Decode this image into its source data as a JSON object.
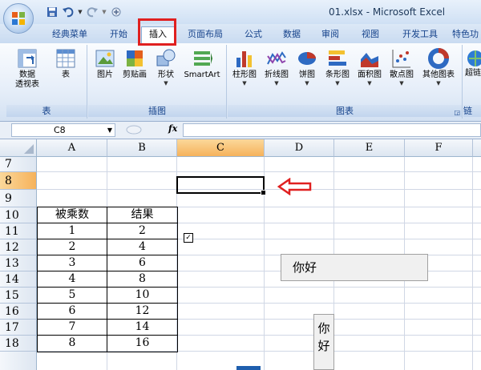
{
  "window": {
    "title": "01.xlsx - Microsoft Excel"
  },
  "quick_access": {
    "icons": [
      "save-icon",
      "undo-icon",
      "redo-icon",
      "customize-icon"
    ]
  },
  "ribbon_tabs": [
    {
      "label": "经典菜单",
      "active": false
    },
    {
      "label": "开始",
      "active": false
    },
    {
      "label": "插入",
      "active": true
    },
    {
      "label": "页面布局",
      "active": false
    },
    {
      "label": "公式",
      "active": false
    },
    {
      "label": "数据",
      "active": false
    },
    {
      "label": "审阅",
      "active": false
    },
    {
      "label": "视图",
      "active": false
    },
    {
      "label": "开发工具",
      "active": false
    },
    {
      "label": "特色功",
      "active": false
    }
  ],
  "ribbon": {
    "groups": {
      "table": "表",
      "illustrations": "插图",
      "charts": "图表",
      "links": "链"
    },
    "buttons": {
      "pivot_line1": "数据",
      "pivot_line2": "透视表",
      "table": "表",
      "picture": "图片",
      "clipart": "剪贴画",
      "shapes": "形状",
      "smartart": "SmartArt",
      "column": "柱形图",
      "line": "折线图",
      "pie": "饼图",
      "bar": "条形图",
      "area": "面积图",
      "scatter": "散点图",
      "other": "其他图表",
      "hyperlink": "超链"
    }
  },
  "formula_bar": {
    "name_box": "C8",
    "fx": "fx",
    "formula": ""
  },
  "columns": [
    "A",
    "B",
    "C",
    "D",
    "E",
    "F"
  ],
  "rows": [
    "7",
    "8",
    "9",
    "10",
    "11",
    "12",
    "13",
    "14",
    "15",
    "16",
    "17",
    "18"
  ],
  "selected": {
    "column": "C",
    "row": "8"
  },
  "table": {
    "header": [
      "被乘数",
      "结果"
    ],
    "rows": [
      [
        "1",
        "2"
      ],
      [
        "2",
        "4"
      ],
      [
        "3",
        "6"
      ],
      [
        "4",
        "8"
      ],
      [
        "5",
        "10"
      ],
      [
        "6",
        "12"
      ],
      [
        "7",
        "14"
      ],
      [
        "8",
        "16"
      ]
    ]
  },
  "controls": {
    "checkbox_checked": true,
    "textbox1": "你好",
    "textbox2": "你好"
  },
  "colors": {
    "annotation_red": "#e02020",
    "selection_orange": "#f6b25b",
    "ribbon_text": "#15428b"
  }
}
